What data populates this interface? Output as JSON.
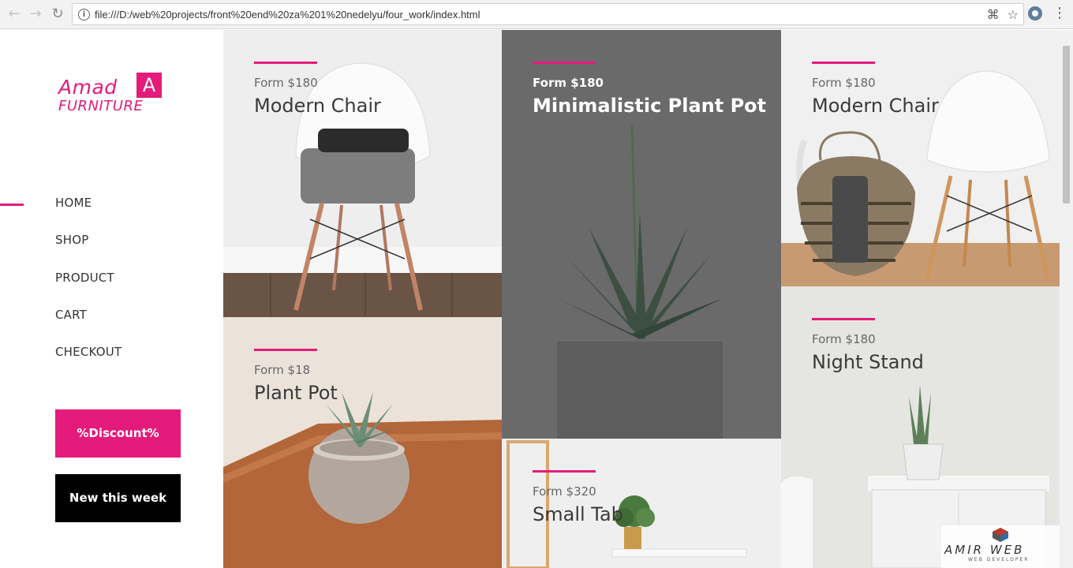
{
  "browser": {
    "url": "file:///D:/web%20projects/front%20end%20za%201%20nedelyu/four_work/index.html",
    "icons": [
      "back-icon",
      "forward-icon",
      "reload-icon",
      "info-icon",
      "translate-icon",
      "star-icon",
      "extension-icon",
      "menu-icon"
    ]
  },
  "logo": {
    "amad": "Amad",
    "mark": "A",
    "furniture": "FURNITURE"
  },
  "nav": {
    "items": [
      "HOME",
      "SHOP",
      "PRODUCT",
      "CART",
      "CHECKOUT"
    ],
    "active": "HOME"
  },
  "buttons": {
    "discount": "%Discount%",
    "new_this_week": "New this week"
  },
  "products": [
    {
      "price": "Form $180",
      "name": "Modern Chair"
    },
    {
      "price": "Form $18",
      "name": "Plant Pot"
    },
    {
      "price": "Form $180",
      "name": "Minimalistic Plant Pot"
    },
    {
      "price": "Form $320",
      "name": "Small Tab"
    },
    {
      "price": "Form $180",
      "name": "Modern Chair"
    },
    {
      "price": "Form $180",
      "name": "Night Stand"
    }
  ],
  "watermark": {
    "title": "AMIR WEB",
    "subtitle": "WEB DEVELOPER"
  },
  "colors": {
    "accent": "#e41b7b",
    "dark_tile": "#6b6b6b"
  }
}
